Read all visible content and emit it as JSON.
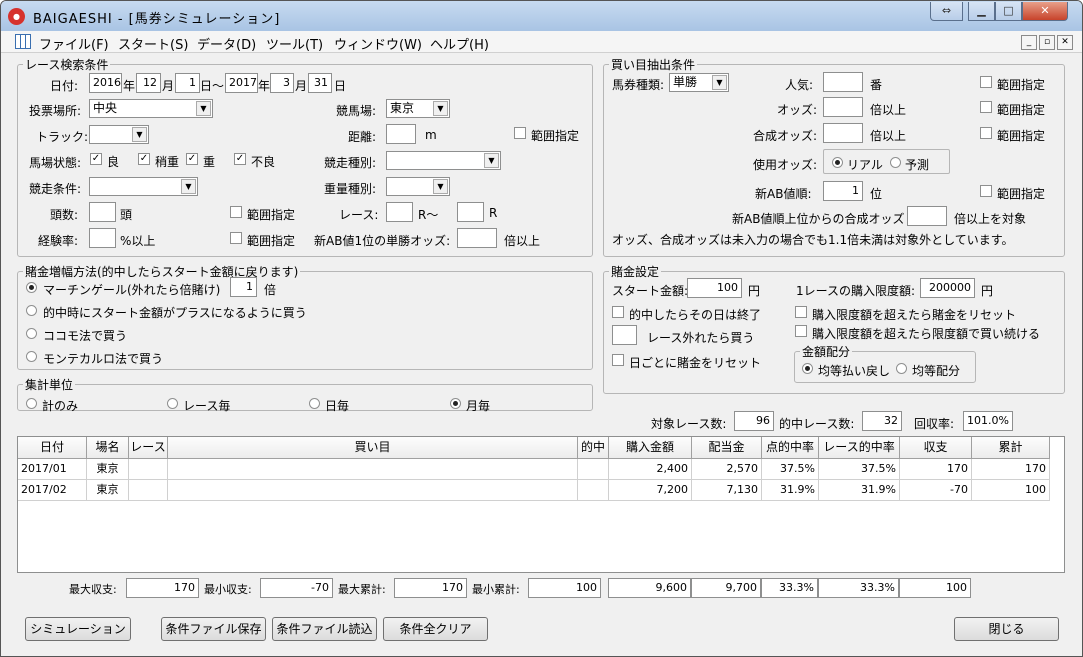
{
  "window": {
    "title": "BAIGAESHI - [馬券シミュレーション]",
    "icon": "app-icon"
  },
  "menu": [
    "ファイル(F)",
    "スタート(S)",
    "データ(D)",
    "ツール(T)",
    "ウィンドウ(W)",
    "ヘルプ(H)"
  ],
  "search": {
    "legend": "レース検索条件",
    "date_label": "日付:",
    "start_year": "2016",
    "start_month": "12",
    "start_day": "1",
    "end_year": "2017",
    "end_month": "3",
    "end_day": "31",
    "year": "年",
    "month": "月",
    "day": "日",
    "day_tilde": "日～",
    "venue_type_label": "投票場所:",
    "venue_type": "中央",
    "course_label": "競馬場:",
    "course": "東京",
    "track_label": "トラック:",
    "track": "",
    "distance_label": "距離:",
    "distance": "",
    "distance_unit": "m",
    "range_label": "範囲指定",
    "condition_label": "馬場状態:",
    "cond_good": "良",
    "cond_slightly": "稍重",
    "cond_heavy": "重",
    "cond_bad": "不良",
    "race_type_label": "競走種別:",
    "race_type": "",
    "race_cond_label": "競走条件:",
    "race_cond": "",
    "weight_label": "重量種別:",
    "weight": "",
    "heads_label": "頭数:",
    "heads": "",
    "heads_unit": "頭",
    "race_label": "レース:",
    "race_from": "",
    "race_r1": "R～",
    "race_to": "",
    "race_r2": "R",
    "exp_label": "経験率:",
    "exp": "",
    "exp_unit": "%以上",
    "ab_odds_label": "新AB値1位の単勝オッズ:",
    "ab_odds": "",
    "ab_odds_unit": "倍以上"
  },
  "buy": {
    "legend": "買い目抽出条件",
    "type_label": "馬券種類:",
    "type": "単勝",
    "pop_label": "人気:",
    "pop": "",
    "pop_unit": "番",
    "odds_label": "オッズ:",
    "odds": "",
    "odds_unit": "倍以上",
    "comp_label": "合成オッズ:",
    "comp": "",
    "comp_unit": "倍以上",
    "use_odds_label": "使用オッズ:",
    "real": "リアル",
    "forecast": "予測",
    "ab_rank_label": "新AB値順:",
    "ab_rank": "1",
    "ab_rank_unit": "位",
    "ab_comp_label": "新AB値順上位からの合成オッズ",
    "ab_comp": "",
    "ab_comp_unit": "倍以上を対象",
    "note": "オッズ、合成オッズは未入力の場合でも1.1倍未満は対象外としています。",
    "range_label": "範囲指定"
  },
  "increase": {
    "legend": "賭金増幅方法(的中したらスタート金額に戻ります)",
    "martingale": "マーチンゲール(外れたら倍賭け)",
    "mult": "1",
    "mult_unit": "倍",
    "plus": "的中時にスタート金額がプラスになるように買う",
    "kokomo": "ココモ法で買う",
    "monte": "モンテカルロ法で買う"
  },
  "bet": {
    "legend": "賭金設定",
    "start_label": "スタート金額:",
    "start": "100",
    "yen": "円",
    "limit_label": "1レースの購入限度額:",
    "limit": "200000",
    "end_on_hit": "的中したらその日は終了",
    "reset_limit": "購入限度額を超えたら賭金をリセット",
    "buy_after_miss": "レース外れたら買う",
    "miss_count": "",
    "keep_limit": "購入限度額を超えたら限度額で買い続ける",
    "reset_daily": "日ごとに賭金をリセット",
    "alloc_legend": "金額配分",
    "alloc_refund": "均等払い戻し",
    "alloc_equal": "均等配分"
  },
  "agg": {
    "legend": "集計単位",
    "total": "計のみ",
    "race": "レース毎",
    "day": "日毎",
    "month": "月毎"
  },
  "stats": {
    "races_label": "対象レース数:",
    "races": "96",
    "hits_label": "的中レース数:",
    "hits": "32",
    "recovery_label": "回収率:",
    "recovery": "101.0%"
  },
  "table": {
    "headers": [
      "日付",
      "場名",
      "レース",
      "買い目",
      "的中",
      "購入金額",
      "配当金",
      "点的中率",
      "レース的中率",
      "収支",
      "累計"
    ],
    "rows": [
      [
        "2017/01",
        "東京",
        "",
        "",
        "",
        "2,400",
        "2,570",
        "37.5%",
        "37.5%",
        "170",
        "170"
      ],
      [
        "2017/02",
        "東京",
        "",
        "",
        "",
        "7,200",
        "7,130",
        "31.9%",
        "31.9%",
        "-70",
        "100"
      ]
    ]
  },
  "summary": {
    "max_income_label": "最大収支:",
    "max_income": "170",
    "min_income_label": "最小収支:",
    "min_income": "-70",
    "max_cum_label": "最大累計:",
    "max_cum": "170",
    "min_cum_label": "最小累計:",
    "min_cum": "100",
    "total_buy": "9,600",
    "total_pay": "9,700",
    "hit_rate": "33.3%",
    "race_hit_rate": "33.3%",
    "cum": "100"
  },
  "buttons": {
    "simulate": "シミュレーション",
    "save": "条件ファイル保存",
    "load": "条件ファイル読込",
    "clear": "条件全クリア",
    "close": "閉じる"
  }
}
